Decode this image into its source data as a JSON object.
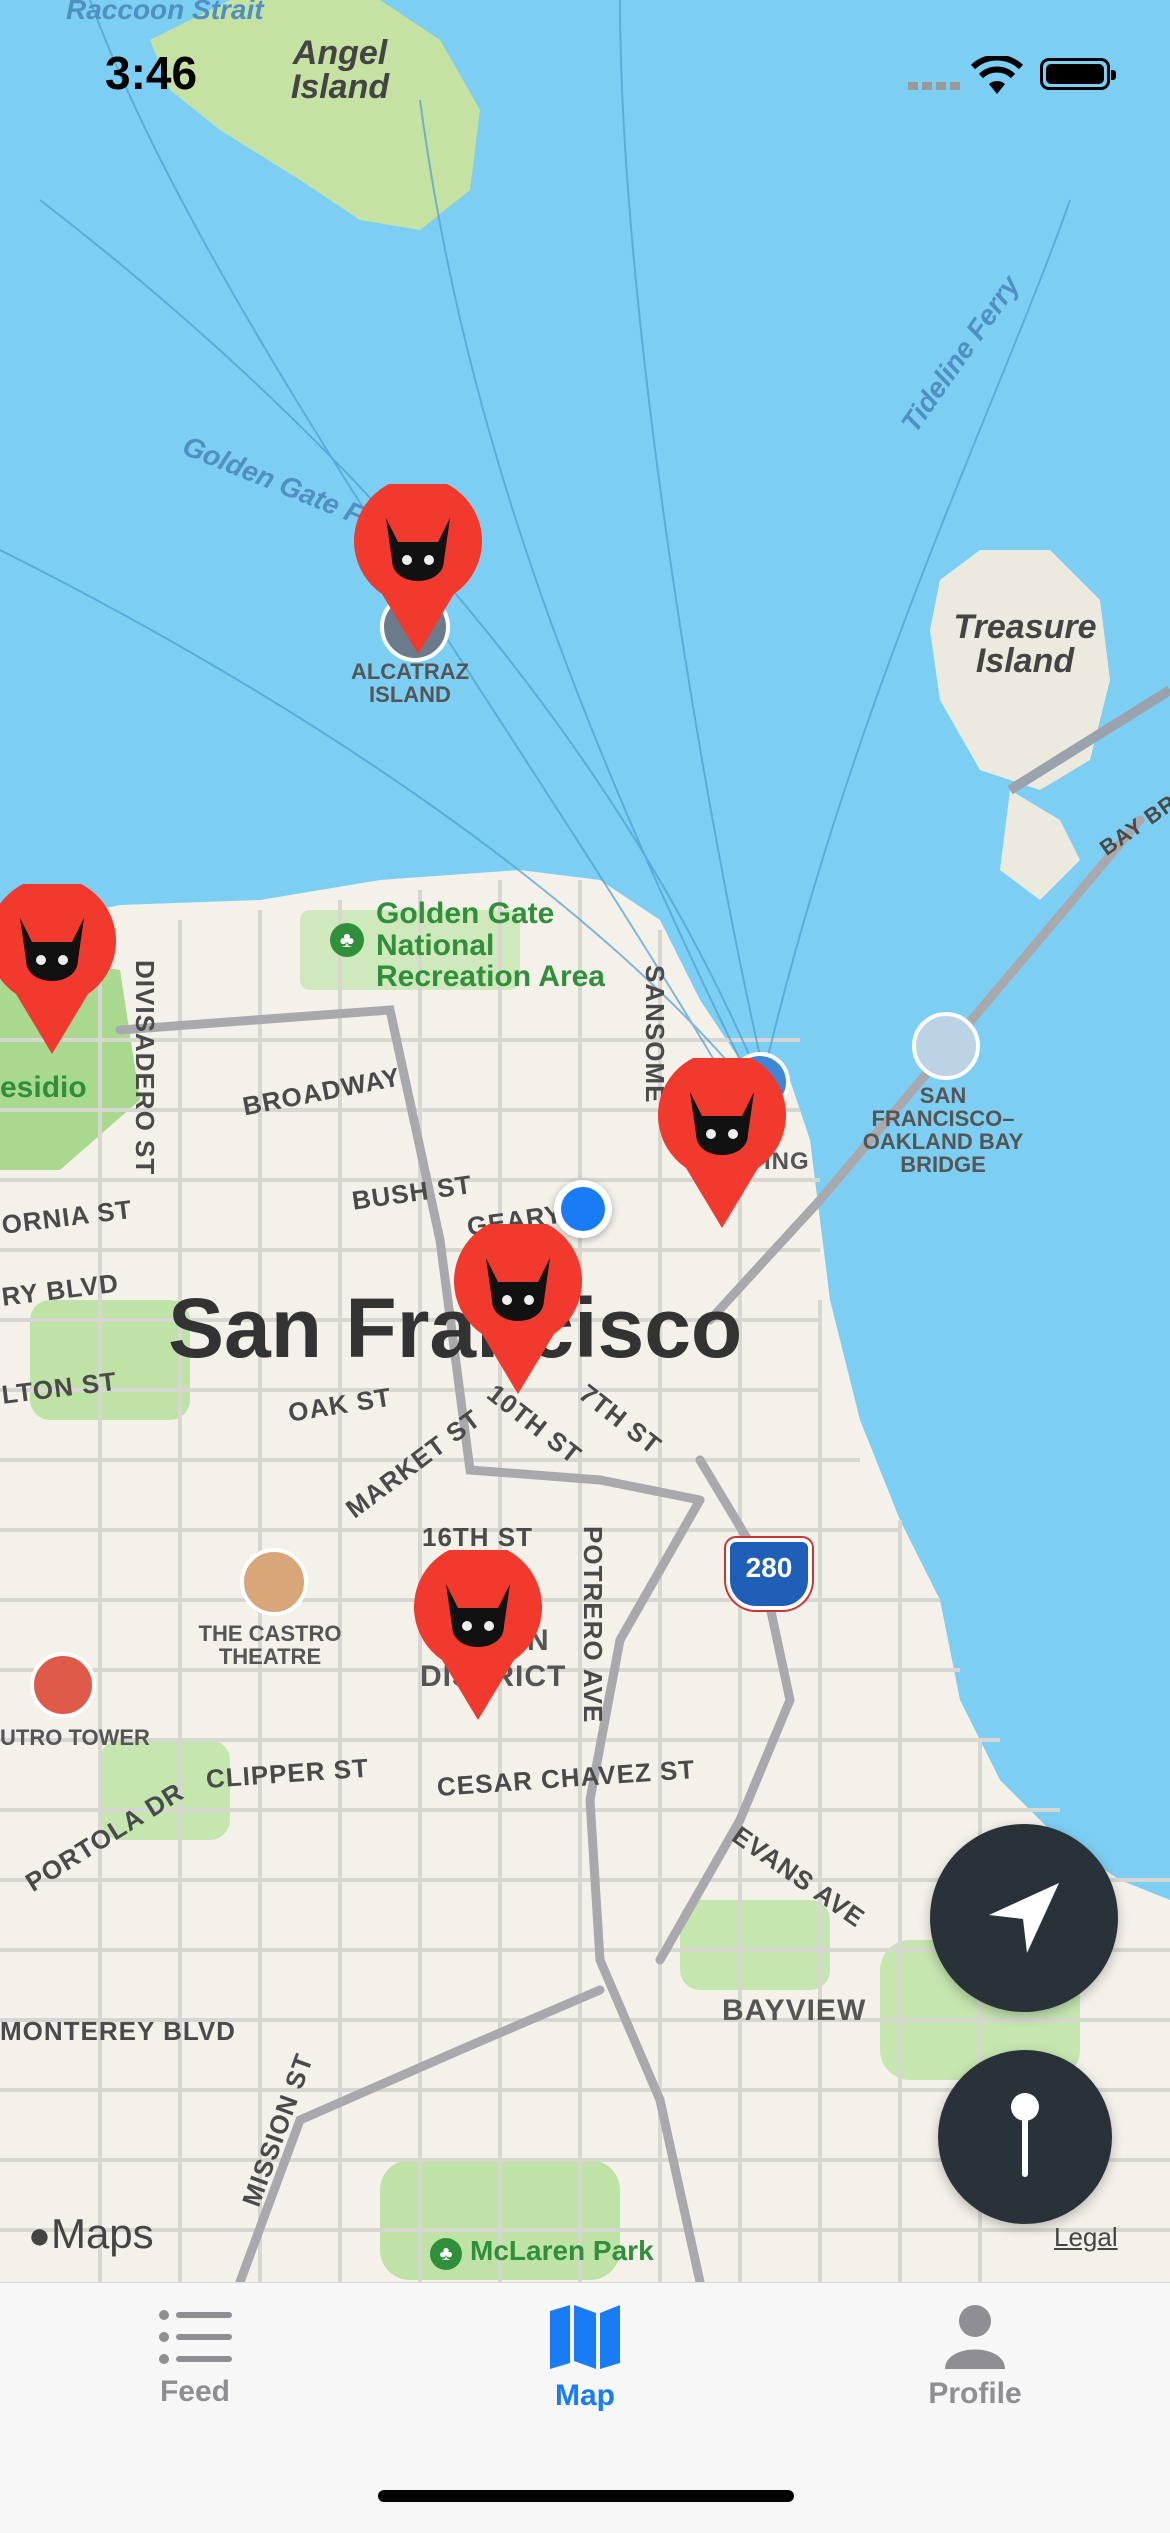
{
  "status_bar": {
    "time": "3:46"
  },
  "map": {
    "water_labels": [
      "Raccoon Strait",
      "Golden Gate Fe",
      "Tideline Ferry"
    ],
    "island_labels": [
      "Angel Island",
      "Treasure Island"
    ],
    "poi_labels": {
      "alcatraz": "ALCATRAZ ISLAND",
      "bay_bridge": "SAN FRANCISCO–OAKLAND BAY BRIDGE",
      "castro": "THE CASTRO THEATRE",
      "sutro": "UTRO TOWER"
    },
    "park_labels": {
      "ggnra": "Golden Gate National Recreation Area",
      "presidio": "esidio",
      "mclaren": "McLaren Park"
    },
    "city_label": "San Francisco",
    "neighborhood_labels": {
      "bayview": "BAYVIEW",
      "mission": "DISTRICT",
      "mission_a": "N",
      "embarcadero": "ING"
    },
    "street_labels": {
      "divisadero": "DIVISADERO ST",
      "broadway": "BROADWAY",
      "bush": "BUSH ST",
      "geary": "GEARY",
      "california": "ORNIA ST",
      "geary_blvd": "RY BLVD",
      "fulton": "LTON ST",
      "oak": "OAK ST",
      "market": "MARKET ST",
      "tenth": "10TH ST",
      "seventh": "7TH ST",
      "sixteenth": "16TH ST",
      "potrero": "POTRERO AVE",
      "sansome": "SANSOME",
      "clipper": "CLIPPER ST",
      "cesar": "CESAR CHAVEZ ST",
      "portola": "PORTOLA DR",
      "evans": "EVANS AVE",
      "monterey": "MONTEREY BLVD",
      "mission_st": "MISSION ST",
      "bay_br": "BAY BR"
    },
    "highway_shield": "280",
    "attribution": "Maps",
    "legal": "Legal"
  },
  "pins": [
    {
      "id": "alcatraz",
      "icon": "cat-icon"
    },
    {
      "id": "presidio",
      "icon": "cat-icon"
    },
    {
      "id": "embarcadero",
      "icon": "cat-icon"
    },
    {
      "id": "soma",
      "icon": "cat-icon"
    },
    {
      "id": "mission",
      "icon": "cat-icon"
    }
  ],
  "tabs": [
    {
      "label": "Feed",
      "icon": "list-icon",
      "active": false
    },
    {
      "label": "Map",
      "icon": "map-icon",
      "active": true
    },
    {
      "label": "Profile",
      "icon": "person-icon",
      "active": false
    }
  ],
  "colors": {
    "accent": "#1a7cf5",
    "pin": "#f2392e",
    "water": "#7ccff3",
    "land": "#f4f1ea",
    "park": "#bfe3a6",
    "fab": "#283238",
    "inactive_tab": "#8e8e93"
  }
}
